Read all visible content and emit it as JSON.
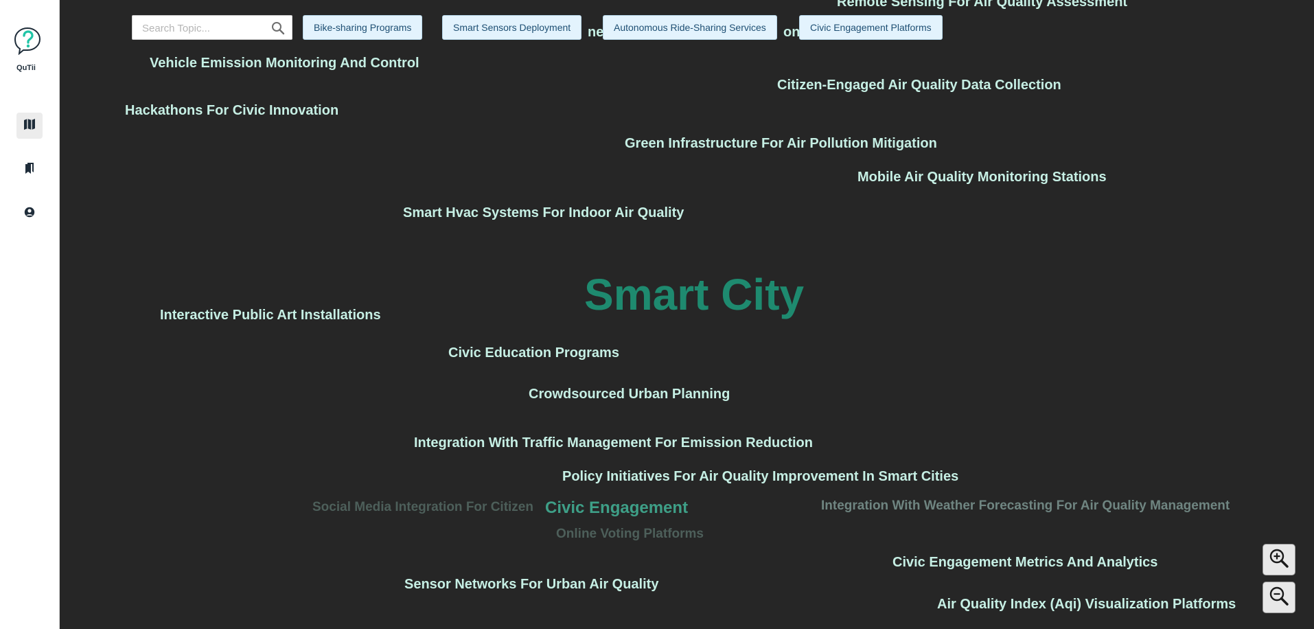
{
  "app": {
    "name": "QuTii"
  },
  "sidebar": {
    "items": [
      {
        "name": "map",
        "icon": "map-icon",
        "active": true
      },
      {
        "name": "bookmarks",
        "icon": "bookmarks-icon",
        "active": false
      },
      {
        "name": "profile",
        "icon": "user-circle-icon",
        "active": false
      }
    ]
  },
  "search": {
    "placeholder": "Search Topic...",
    "value": "",
    "icon": "search-icon"
  },
  "filters": [
    "Bike-sharing Programs",
    "Smart Sensors Deployment",
    "Autonomous Ride-Sharing Services",
    "Civic Engagement Platforms"
  ],
  "words": {
    "remote_sensing": "Remote Sensing For Air Quality Assessment",
    "partial_behind": "nes",
    "partial_behind2": "on",
    "vehicle_emission": "Vehicle Emission Monitoring And Control",
    "citizen_engaged": "Citizen-Engaged Air Quality Data Collection",
    "hackathons": "Hackathons For Civic Innovation",
    "green_infra": "Green Infrastructure For Air Pollution Mitigation",
    "mobile_air": "Mobile Air Quality Monitoring Stations",
    "smart_hvac": "Smart Hvac Systems For Indoor Air Quality",
    "smart_city": "Smart City",
    "public_art": "Interactive Public Art Installations",
    "civic_education": "Civic Education Programs",
    "crowdsourced": "Crowdsourced Urban Planning",
    "traffic_integration": "Integration With Traffic Management For Emission Reduction",
    "policy": "Policy Initiatives For Air Quality Improvement In Smart Cities",
    "social_media": "Social Media Integration For Citizen",
    "civic_engagement": "Civic Engagement",
    "weather": "Integration With Weather Forecasting For Air Quality Management",
    "online_voting": "Online Voting Platforms",
    "metrics": "Civic Engagement Metrics And Analytics",
    "sensor_networks": "Sensor Networks For Urban Air Quality",
    "aqi": "Air Quality Index (Aqi) Visualization Platforms"
  },
  "zoom": {
    "in_icon": "zoom-in-icon",
    "out_icon": "zoom-out-icon"
  },
  "colors": {
    "background": "#262626",
    "topic": "#c6efe4",
    "main_topic": "#1e8a6f",
    "secondary_topic": "#3e9f87",
    "chip_bg": "#e3f3fd",
    "chip_text": "#1e4f73"
  }
}
